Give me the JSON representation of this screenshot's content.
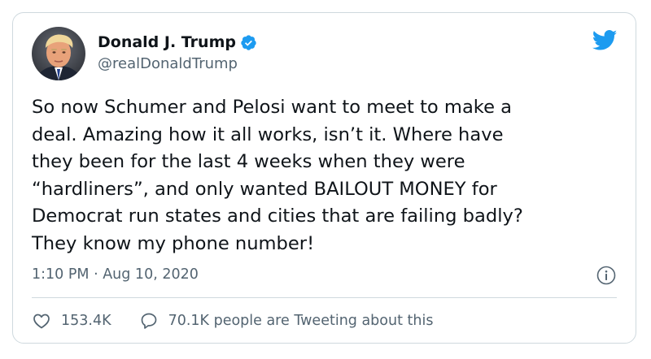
{
  "tweet": {
    "display_name": "Donald J. Trump",
    "handle": "@realDonaldTrump",
    "verified": true,
    "text": "So now Schumer and Pelosi want to meet to make a\ndeal. Amazing how it all works, isn’t it. Where have\nthey been for the last 4 weeks when they were\n“hardliners”, and only wanted BAILOUT MONEY for\nDemocrat run states and cities that are failing badly?\nThey know my phone number!",
    "timestamp": "1:10 PM · Aug 10, 2020",
    "likes": "153.4K",
    "conversation": "70.1K people are Tweeting about this"
  },
  "icons": {
    "brand": "twitter-bird-icon",
    "verified": "verified-badge-icon",
    "info": "info-icon",
    "like": "heart-icon",
    "reply": "speech-bubble-icon"
  },
  "colors": {
    "brand_blue": "#1d9bf0",
    "text": "#0f1419",
    "secondary": "#536471",
    "border": "#cfd9de"
  }
}
